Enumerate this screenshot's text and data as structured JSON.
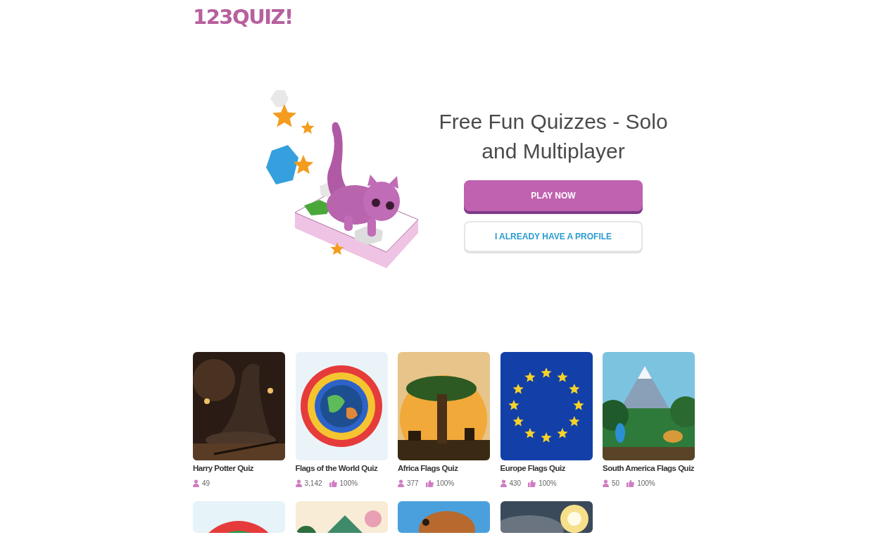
{
  "logo": "123QUIZ!",
  "hero": {
    "title": "Free Fun Quizzes - Solo and Multiplayer",
    "buttons": [
      {
        "kind": "primary",
        "label": "PLAY NOW"
      },
      {
        "kind": "secondary",
        "label": "I ALREADY HAVE A PROFILE"
      }
    ]
  },
  "quizzes": [
    {
      "title": "Harry Potter Quiz",
      "players": "49"
    },
    {
      "title": "Flags of the World Quiz",
      "players": "3,142",
      "likes": "100%"
    },
    {
      "title": "Africa Flags Quiz",
      "players": "377",
      "likes": "100%"
    },
    {
      "title": "Europe Flags Quiz",
      "players": "430",
      "likes": "100%"
    },
    {
      "title": "South America Flags Quiz",
      "players": "50",
      "likes": "100%"
    }
  ]
}
